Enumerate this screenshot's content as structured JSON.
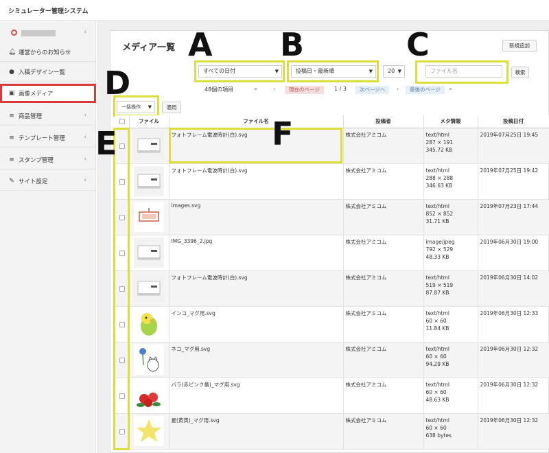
{
  "app": {
    "title": "シミュレーター管理システム"
  },
  "sidebar": {
    "items": [
      {
        "label": "運営からのお知らせ",
        "icon": "bell-icon"
      },
      {
        "label": "入稿デザイン一覧",
        "icon": "users-icon"
      },
      {
        "label": "画像メディア",
        "icon": "image-file-icon"
      },
      {
        "label": "商品管理",
        "icon": "database-icon"
      },
      {
        "label": "テンプレート管理",
        "icon": "database-icon"
      },
      {
        "label": "スタンプ管理",
        "icon": "database-icon"
      },
      {
        "label": "サイト設定",
        "icon": "wrench-icon"
      }
    ]
  },
  "page": {
    "title": "メディア一覧",
    "new_button": "新規追加",
    "date_filter": "すべての日付",
    "sort": "投稿日・最新順",
    "per_page": "20",
    "search_placeholder": "ファイル名",
    "search_button": "検索",
    "item_count": "48個の項目",
    "pagination": {
      "first": "«",
      "prev": "‹",
      "current_page_label": "現在のページ",
      "page_info": "1 / 3",
      "next_label": "次ページへ",
      "next_arrow": "›",
      "last_label": "最後のページ",
      "last_arrow": "»"
    },
    "bulk_action": "一括操作",
    "apply_button": "適用"
  },
  "annotations": [
    "A",
    "B",
    "C",
    "D",
    "E",
    "F"
  ],
  "table": {
    "headers": [
      "ファイル",
      "ファイル名",
      "投稿者",
      "メタ情報",
      "投稿日付"
    ],
    "rows": [
      {
        "thumb": "clock-frame",
        "file": "フォトフレーム電波時計(白).svg",
        "poster": "株式会社アミコム",
        "type": "text/html",
        "dim": "287 × 191",
        "size": "345.72 KB",
        "date": "2019年07月25日 19:45"
      },
      {
        "thumb": "clock-frame",
        "file": "フォトフレーム電波時計(白).svg",
        "poster": "株式会社アミコム",
        "type": "text/html",
        "dim": "288 × 288",
        "size": "346.63 KB",
        "date": "2019年07月25日 19:42"
      },
      {
        "thumb": "tag-red",
        "file": "images.svg",
        "poster": "株式会社アミコム",
        "type": "text/html",
        "dim": "852 × 852",
        "size": "31.71 KB",
        "date": "2019年07月23日 17:44"
      },
      {
        "thumb": "clock-frame",
        "file": "IMG_3396_2.jpg",
        "poster": "株式会社アミコム",
        "type": "image/jpeg",
        "dim": "792 × 529",
        "size": "48.33 KB",
        "date": "2019年06月30日 19:00"
      },
      {
        "thumb": "clock-frame",
        "file": "フォトフレーム電波時計(白).svg",
        "poster": "株式会社アミコム",
        "type": "text/html",
        "dim": "519 × 519",
        "size": "87.87 KB",
        "date": "2019年06月30日 14:02"
      },
      {
        "thumb": "parakeet",
        "file": "インコ_マグ用.svg",
        "poster": "株式会社アミコム",
        "type": "text/html",
        "dim": "60 × 60",
        "size": "11.84 KB",
        "date": "2019年06月30日 12:33"
      },
      {
        "thumb": "cat",
        "file": "ネコ_マグ用.svg",
        "poster": "株式会社アミコム",
        "type": "text/html",
        "dim": "60 × 60",
        "size": "94.29 KB",
        "date": "2019年06月30日 12:32"
      },
      {
        "thumb": "roses",
        "file": "バラ(赤ピンク薔)_マグ用.svg",
        "poster": "株式会社アミコム",
        "type": "text/html",
        "dim": "60 × 60",
        "size": "48.63 KB",
        "date": "2019年06月30日 12:32"
      },
      {
        "thumb": "star",
        "file": "星(黄黄)_マグ用.svg",
        "poster": "株式会社アミコム",
        "type": "text/html",
        "dim": "60 × 60",
        "size": "638 bytes",
        "date": "2019年06月30日 12:32"
      }
    ]
  },
  "colors": {
    "highlight": "#dcdf3a",
    "active_nav": "#d93a3a",
    "annotation_text": "#111111"
  }
}
